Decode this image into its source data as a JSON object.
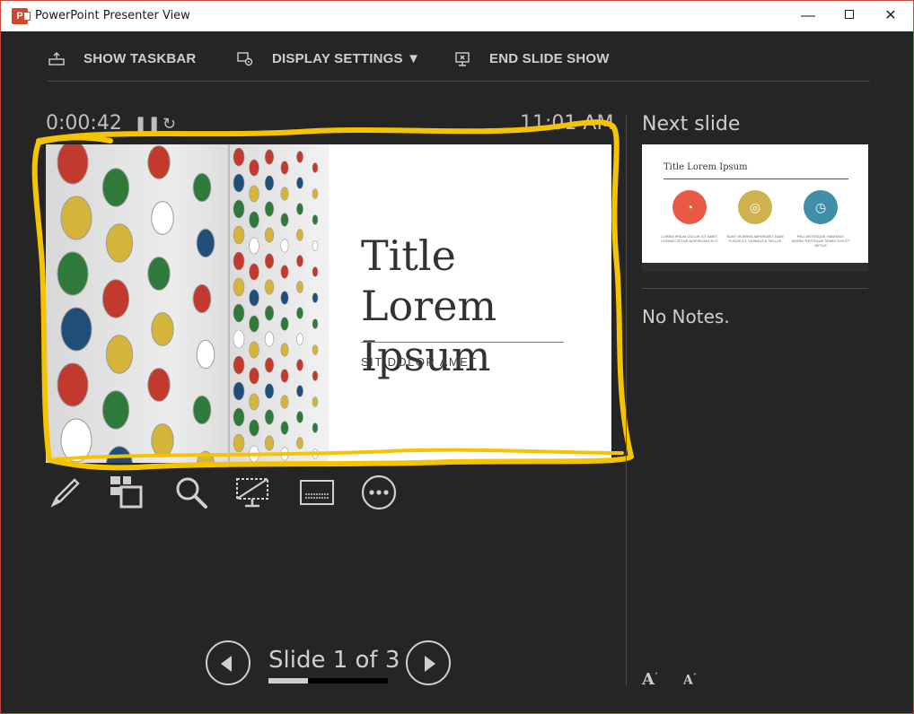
{
  "window": {
    "title": "PowerPoint Presenter View",
    "app_icon": "powerpoint-icon",
    "controls": [
      "minimize",
      "maximize",
      "close"
    ]
  },
  "toolbar": {
    "show_taskbar": "SHOW TASKBAR",
    "display_settings": "DISPLAY SETTINGS",
    "end_slide_show": "END SLIDE SHOW"
  },
  "timer": {
    "elapsed": "0:00:42",
    "clock": "11:01 AM"
  },
  "current_slide": {
    "title": "Title Lorem Ipsum",
    "subtitle": "SIT DOLOR AMET"
  },
  "annotation": {
    "color": "#f5c400"
  },
  "tools": [
    "pen-tool-icon",
    "see-all-slides-icon",
    "zoom-icon",
    "black-screen-icon",
    "subtitles-icon",
    "more-options-icon"
  ],
  "navigation": {
    "counter": "Slide 1 of 3",
    "current": 1,
    "total": 3
  },
  "next_slide": {
    "label": "Next slide",
    "title": "Title Lorem Ipsum",
    "circle_colors": [
      "#e85a45",
      "#cfb24e",
      "#3f8fa8"
    ],
    "captions": [
      "LOREM IPSUM DOLOR SIT AMET, CONSECTETUR ADIPISCING ELIT",
      "SUNT VIVERRA IMPERDIET DIAM FUSCE ET, VIVAMUS A TELLUS",
      "PELLENTESQUE HABITANT MORBI TRISTIQUE SENECTUS ET NETUS"
    ]
  },
  "notes": {
    "text": "No Notes."
  },
  "font_controls": {
    "increase": "A",
    "decrease": "A"
  },
  "colors": {
    "background": "#252525",
    "text": "#cfcfcf",
    "window_border": "#c4463a"
  }
}
